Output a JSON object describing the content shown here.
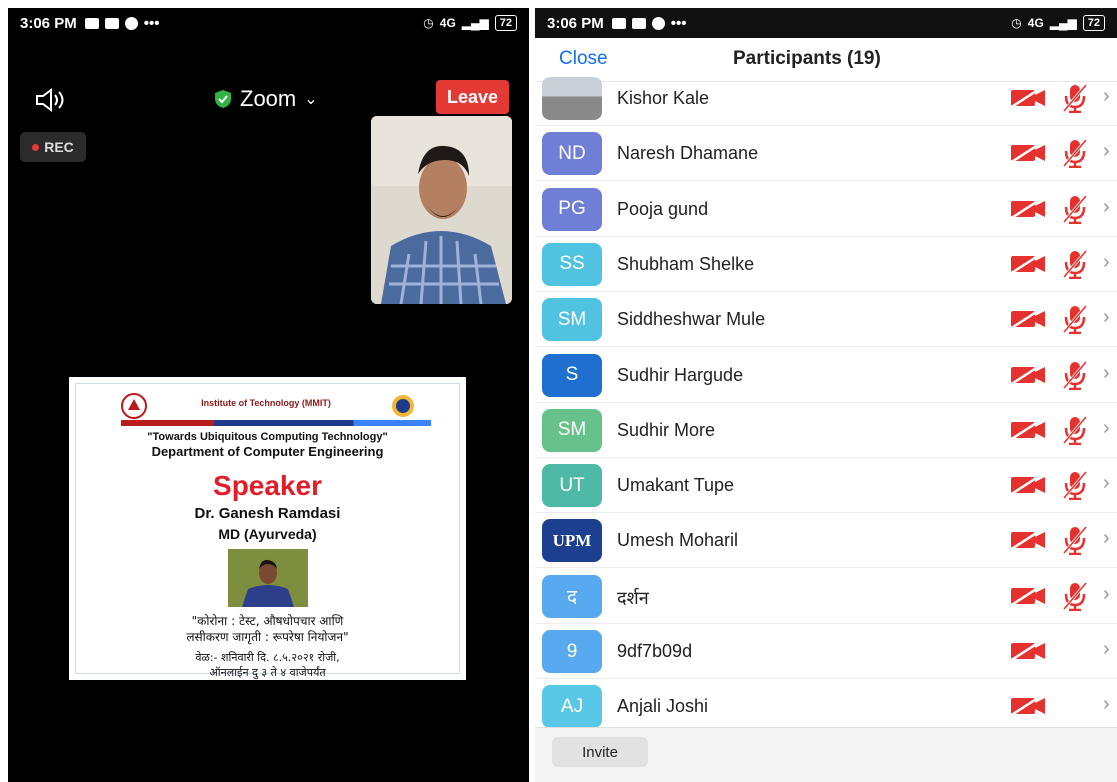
{
  "left_screen": {
    "status": {
      "time": "3:06 PM",
      "network": "4G",
      "battery": "72"
    },
    "meeting_title": "Zoom",
    "leave_label": "Leave",
    "rec_label": "REC",
    "poster": {
      "institute": "Institute of Technology (MMIT)",
      "tagline": "\"Towards Ubiquitous Computing Technology\"",
      "department": "Department of Computer Engineering",
      "speaker_heading": "Speaker",
      "speaker_name": "Dr. Ganesh Ramdasi",
      "speaker_degree": "MD (Ayurveda)",
      "topic_line1": "\"कोरोना : टेस्ट, औषधोपचार आणि",
      "topic_line2": "लसीकरण जागृती : रूपरेषा नियोजन\"",
      "time_line1": "वेळ:- शनिवारी दि. ८.५.२०२१ रोजी,",
      "time_line2": "ऑनलाईन  दु ३ ते ४ वाजेपर्यंत"
    }
  },
  "right_screen": {
    "status": {
      "time": "3:06 PM",
      "network": "4G",
      "battery": "72"
    },
    "close_label": "Close",
    "title": "Participants (19)",
    "participants": [
      {
        "initials": "",
        "name": "Kishor Kale",
        "color": "#8a8a8a",
        "mic": true
      },
      {
        "initials": "ND",
        "name": "Naresh Dhamane",
        "color": "#6f7fd6",
        "mic": true
      },
      {
        "initials": "PG",
        "name": "Pooja gund",
        "color": "#6f7fd6",
        "mic": true
      },
      {
        "initials": "SS",
        "name": "Shubham Shelke",
        "color": "#4fc3e0",
        "mic": true
      },
      {
        "initials": "SM",
        "name": "Siddheshwar Mule",
        "color": "#4fc3e0",
        "mic": true
      },
      {
        "initials": "S",
        "name": "Sudhir Hargude",
        "color": "#1e6fd0",
        "mic": true
      },
      {
        "initials": "SM",
        "name": "Sudhir More",
        "color": "#66c28a",
        "mic": true
      },
      {
        "initials": "UT",
        "name": "Umakant Tupe",
        "color": "#4fb9a8",
        "mic": true
      },
      {
        "initials": "UPM",
        "name": "Umesh Moharil",
        "color": "#1d3f8f",
        "mic": true
      },
      {
        "initials": "द",
        "name": "दर्शन",
        "color": "#58a9f0",
        "mic": true
      },
      {
        "initials": "9",
        "name": "9df7b09d",
        "color": "#58a9f0",
        "mic": false
      },
      {
        "initials": "AJ",
        "name": "Anjali Joshi",
        "color": "#58c8e6",
        "mic": false
      }
    ],
    "invite_label": "Invite"
  }
}
